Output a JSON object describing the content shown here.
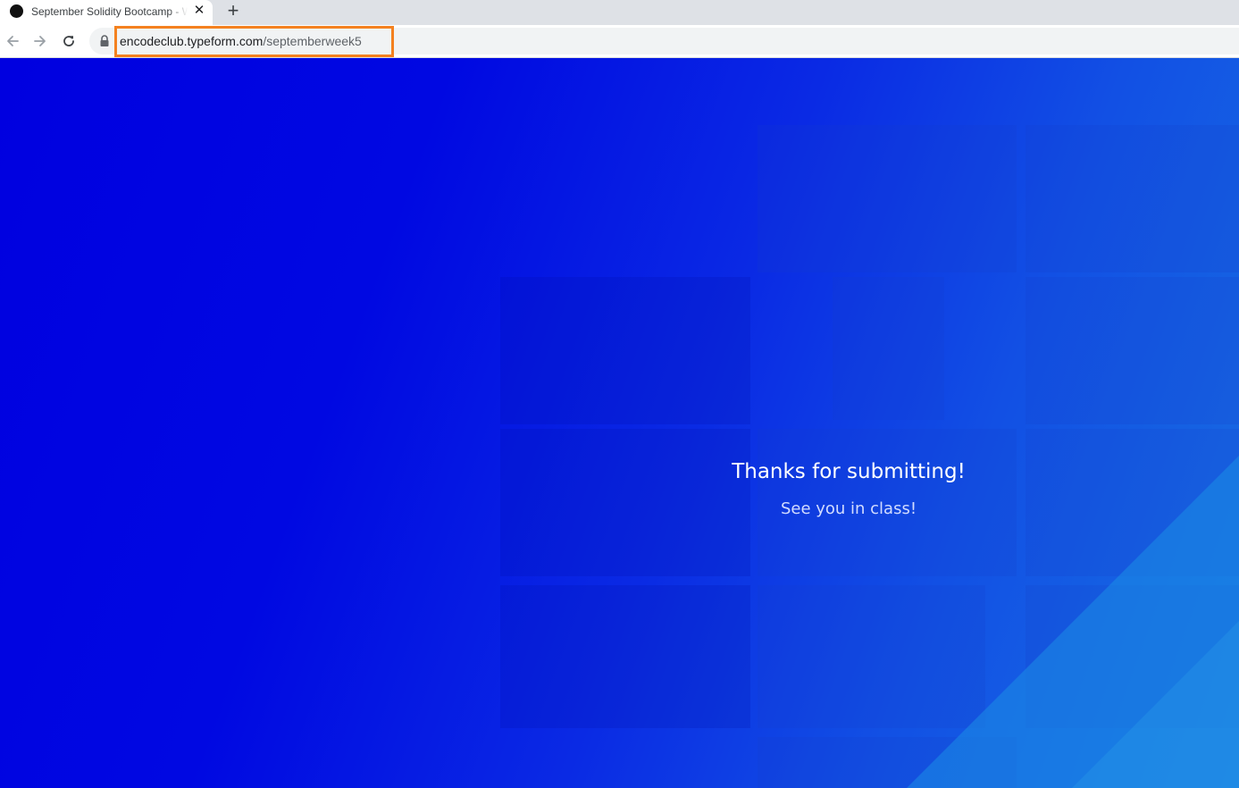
{
  "browser": {
    "tab": {
      "title": "September Solidity Bootcamp - W",
      "favicon": "circle-favicon-icon",
      "close_icon": "close-icon"
    },
    "new_tab_icon": "plus-icon",
    "nav": {
      "back_icon": "back-arrow-icon",
      "forward_icon": "forward-arrow-icon",
      "reload_icon": "reload-icon"
    },
    "address_bar": {
      "lock_icon": "lock-icon",
      "url_host": "encodeclub.typeform.com",
      "url_path": "/septemberweek5",
      "highlight_color": "#f4811f"
    }
  },
  "page": {
    "background_color": "#0000e0",
    "title": "Thanks for submitting!",
    "subtitle": "See you in class!"
  }
}
